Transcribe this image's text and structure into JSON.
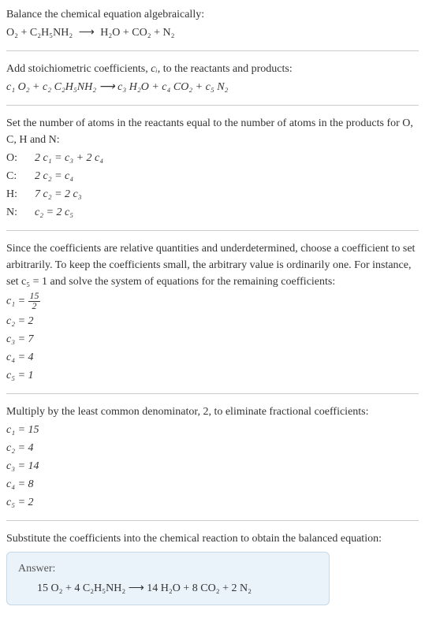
{
  "intro": {
    "title": "Balance the chemical equation algebraically:",
    "equation_lhs": "O₂ + C₂H₅NH₂",
    "arrow": "⟶",
    "equation_rhs": "H₂O + CO₂ + N₂"
  },
  "stoich": {
    "title_prefix": "Add stoichiometric coefficients, ",
    "title_var": "cᵢ",
    "title_suffix": ", to the reactants and products:",
    "equation": "c₁ O₂ + c₂ C₂H₅NH₂  ⟶  c₃ H₂O + c₄ CO₂ + c₅ N₂"
  },
  "atoms": {
    "title": "Set the number of atoms in the reactants equal to the number of atoms in the products for O, C, H and N:",
    "rows": [
      {
        "el": "O:",
        "eq": "2 c₁ = c₃ + 2 c₄"
      },
      {
        "el": "C:",
        "eq": "2 c₂ = c₄"
      },
      {
        "el": "H:",
        "eq": "7 c₂ = 2 c₃"
      },
      {
        "el": "N:",
        "eq": "c₂ = 2 c₅"
      }
    ]
  },
  "underdetermined": {
    "text": "Since the coefficients are relative quantities and underdetermined, choose a coefficient to set arbitrarily. To keep the coefficients small, the arbitrary value is ordinarily one. For instance, set c₅ = 1 and solve the system of equations for the remaining coefficients:",
    "c1_label": "c₁ = ",
    "c1_num": "15",
    "c1_den": "2",
    "c2": "c₂ = 2",
    "c3": "c₃ = 7",
    "c4": "c₄ = 4",
    "c5": "c₅ = 1"
  },
  "lcd": {
    "text": "Multiply by the least common denominator, 2, to eliminate fractional coefficients:",
    "c1": "c₁ = 15",
    "c2": "c₂ = 4",
    "c3": "c₃ = 14",
    "c4": "c₄ = 8",
    "c5": "c₅ = 2"
  },
  "substitute": {
    "text": "Substitute the coefficients into the chemical reaction to obtain the balanced equation:"
  },
  "answer": {
    "label": "Answer:",
    "equation": "15 O₂ + 4 C₂H₅NH₂  ⟶  14 H₂O + 8 CO₂ + 2 N₂"
  }
}
